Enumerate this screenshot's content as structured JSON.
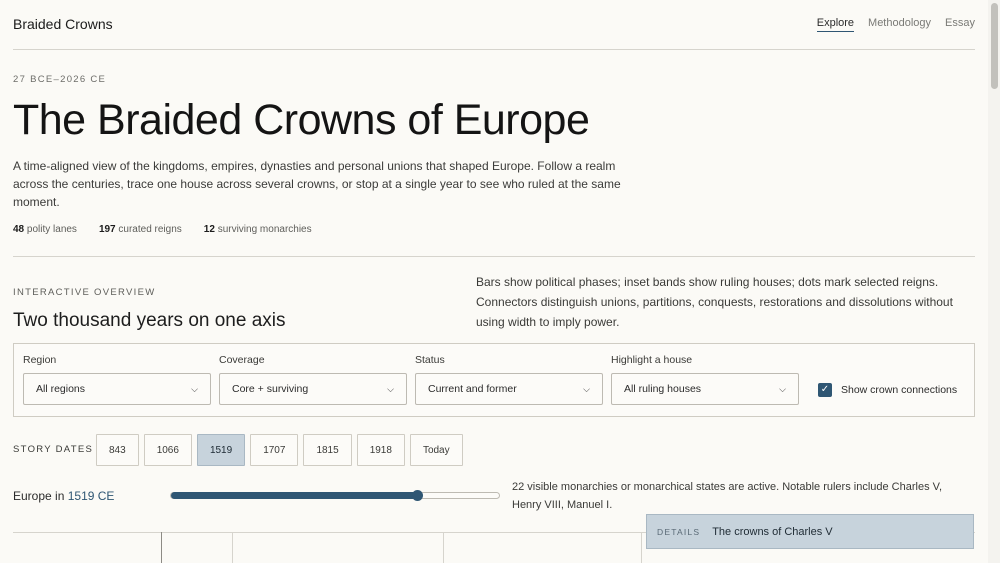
{
  "header": {
    "brand": "Braided Crowns",
    "nav": [
      {
        "label": "Explore",
        "active": true
      },
      {
        "label": "Methodology",
        "active": false
      },
      {
        "label": "Essay",
        "active": false
      }
    ]
  },
  "hero": {
    "eyebrow": "27 BCE–2026 CE",
    "title": "The Braided Crowns of Europe",
    "lede": "A time-aligned view of the kingdoms, empires, dynasties and personal unions that shaped Europe. Follow a realm across the centuries, trace one house across several crowns, or stop at a single year to see who ruled at the same moment.",
    "stats": [
      {
        "value": "48",
        "label": "polity lanes"
      },
      {
        "value": "197",
        "label": "curated reigns"
      },
      {
        "value": "12",
        "label": "surviving monarchies"
      }
    ]
  },
  "overview": {
    "eyebrow": "INTERACTIVE OVERVIEW",
    "title": "Two thousand years on one axis",
    "description": "Bars show political phases; inset bands show ruling houses; dots mark selected reigns. Connectors distinguish unions, partitions, conquests, restorations and dissolutions without using width to imply power."
  },
  "filters": {
    "region": {
      "label": "Region",
      "value": "All regions"
    },
    "coverage": {
      "label": "Coverage",
      "value": "Core + surviving"
    },
    "status": {
      "label": "Status",
      "value": "Current and former"
    },
    "house": {
      "label": "Highlight a house",
      "value": "All ruling houses"
    },
    "connections": {
      "label": "Show crown connections",
      "checked": true
    }
  },
  "story": {
    "label": "STORY DATES",
    "dates": [
      "843",
      "1066",
      "1519",
      "1707",
      "1815",
      "1918",
      "Today"
    ],
    "active": "1519"
  },
  "year": {
    "prefix": "Europe in",
    "value": "1519 CE",
    "slider_fraction": 0.75,
    "note": "22 visible monarchies or monarchical states are active. Notable rulers include Charles V, Henry VIII, Manuel I."
  },
  "details": {
    "label": "DETAILS",
    "title": "The crowns of Charles V"
  },
  "icons": {
    "dropdown": "chevron-down-icon",
    "checkbox": "check-icon"
  },
  "colors": {
    "accent": "#2f5673",
    "active_bg": "#c7d3dc",
    "background": "#fbfaf6"
  }
}
